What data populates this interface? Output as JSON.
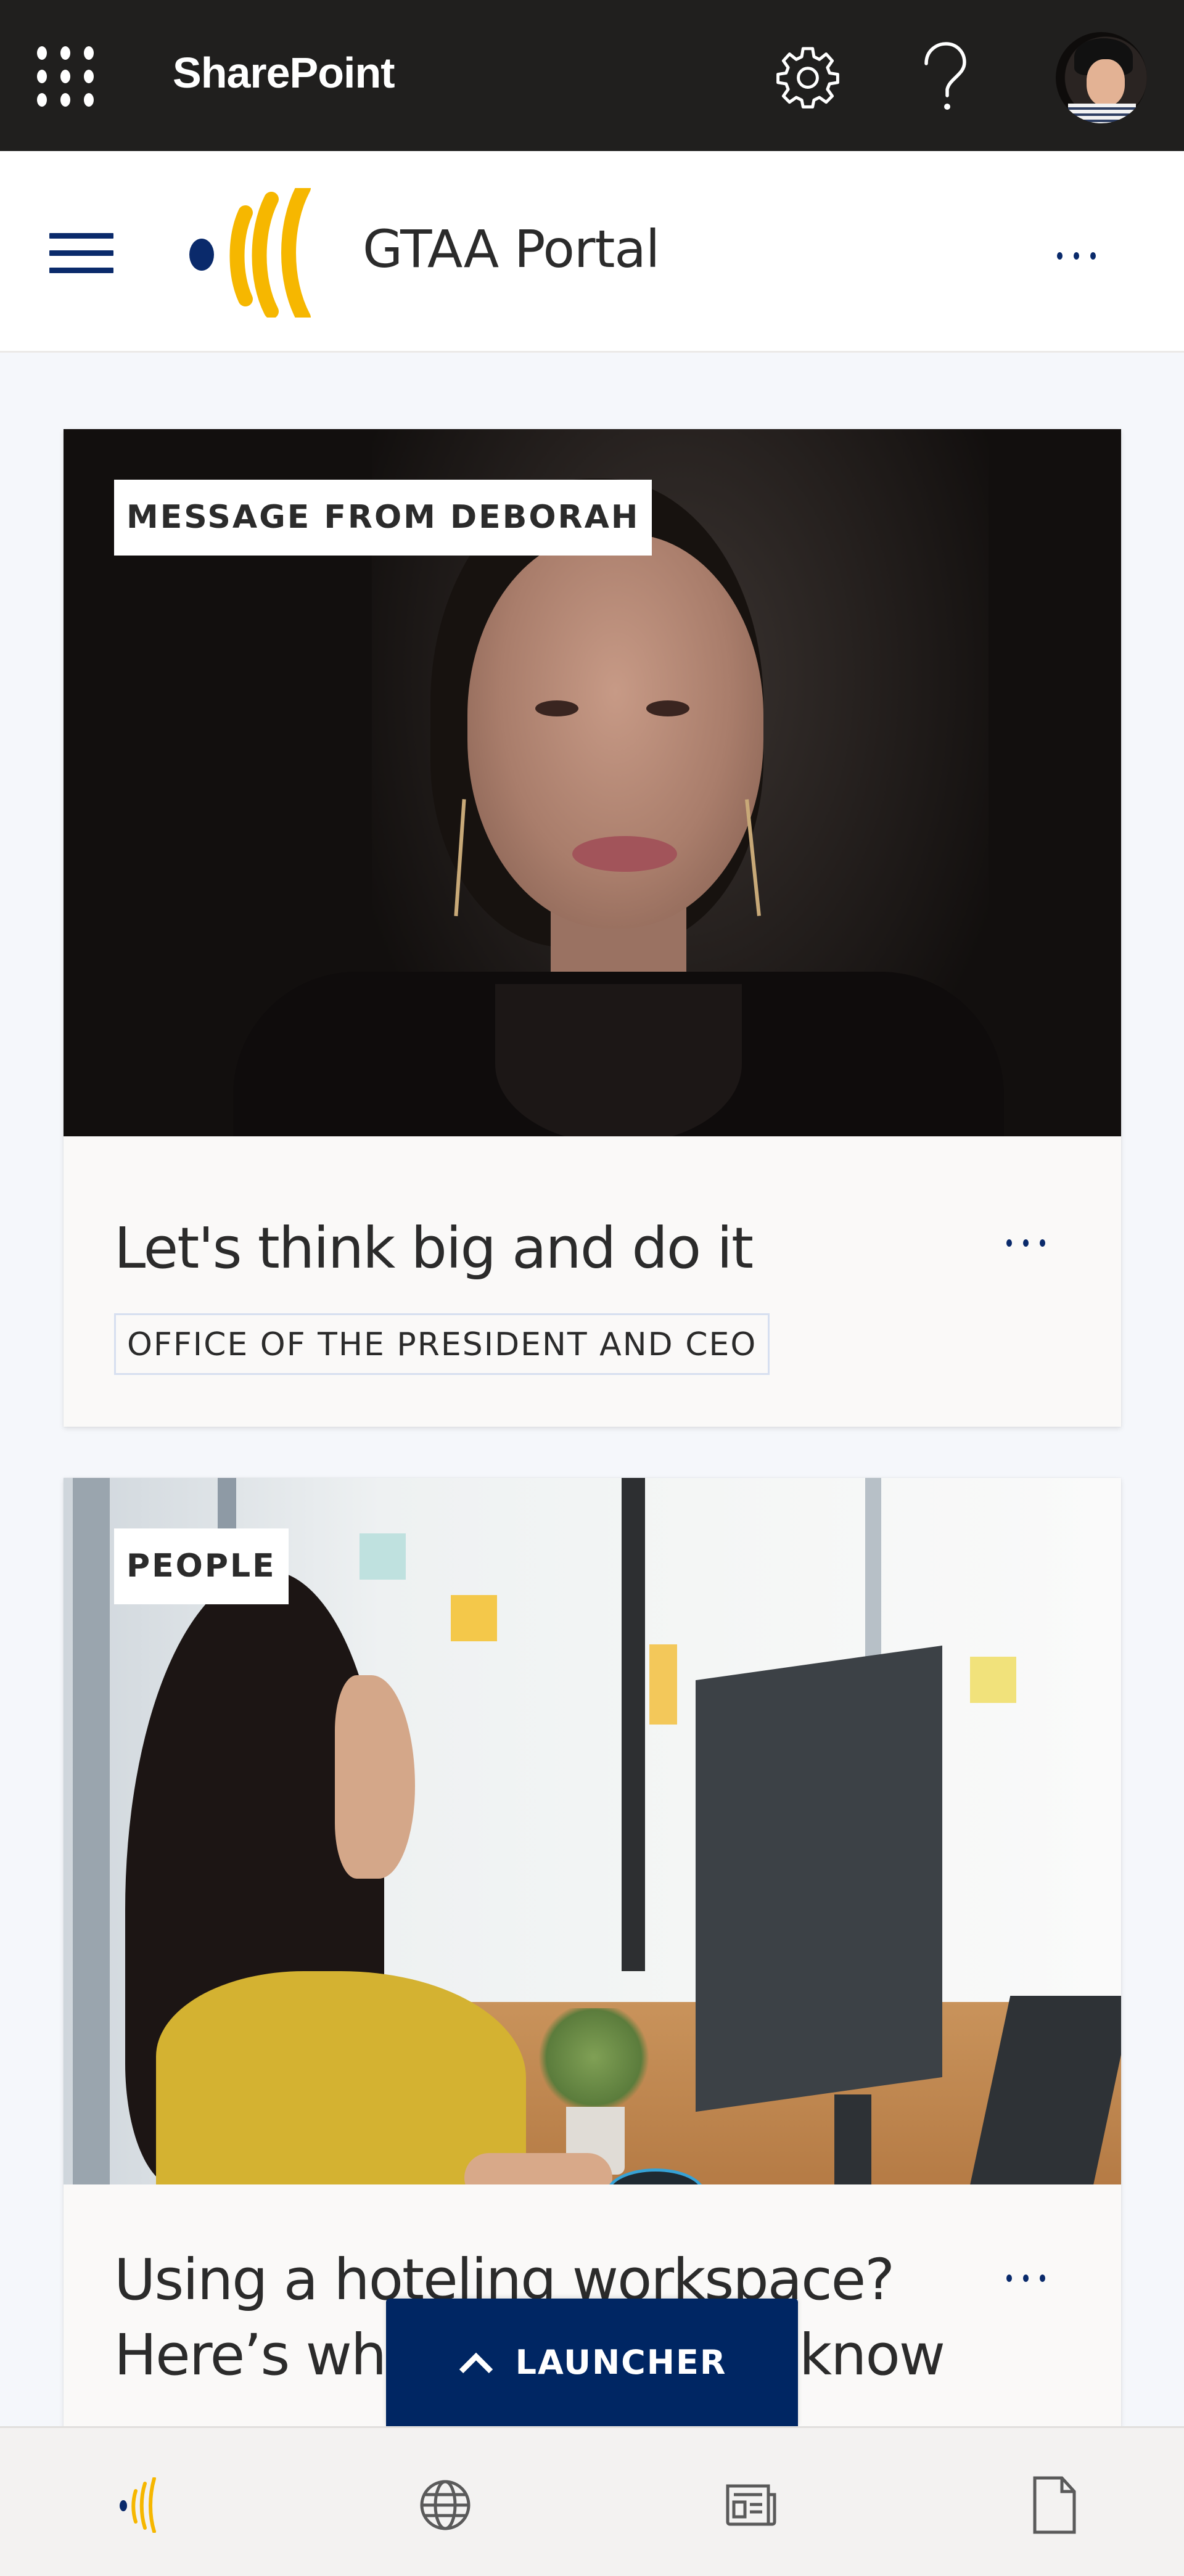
{
  "suite_bar": {
    "app_name": "SharePoint",
    "icons": {
      "app_launcher": "waffle-icon",
      "settings": "gear-icon",
      "help": "question-mark-icon",
      "account": "user-avatar"
    }
  },
  "site_header": {
    "title": "GTAA Portal",
    "menu_icon": "hamburger-icon",
    "more_icon": "more-horizontal-icon"
  },
  "colors": {
    "suite_bar_bg": "#201f1e",
    "brand_navy": "#002663",
    "brand_gold": "#f6b700",
    "page_bg": "#f5f7fb",
    "card_bg": "#faf9f8",
    "text_primary": "#2b2b2b"
  },
  "news": [
    {
      "label": "MESSAGE FROM DEBORAH",
      "title": "Let's think big and do it",
      "topic": "OFFICE OF THE PRESIDENT AND CEO",
      "image": "portrait-photo"
    },
    {
      "label": "PEOPLE",
      "title": "Using a hoteling workspace? Here’s what you need to know",
      "title_visible": "Using a hoteling workspace? Here’s wh",
      "title_line3": "know",
      "image": "office-desk-photo"
    }
  ],
  "launcher": {
    "label": "LAUNCHER",
    "icon": "chevron-up-icon"
  },
  "bottom_nav": {
    "items": [
      {
        "name": "home",
        "icon": "gtaa-logo-icon"
      },
      {
        "name": "sites",
        "icon": "globe-icon"
      },
      {
        "name": "news",
        "icon": "newspaper-icon"
      },
      {
        "name": "files",
        "icon": "document-icon"
      }
    ]
  }
}
